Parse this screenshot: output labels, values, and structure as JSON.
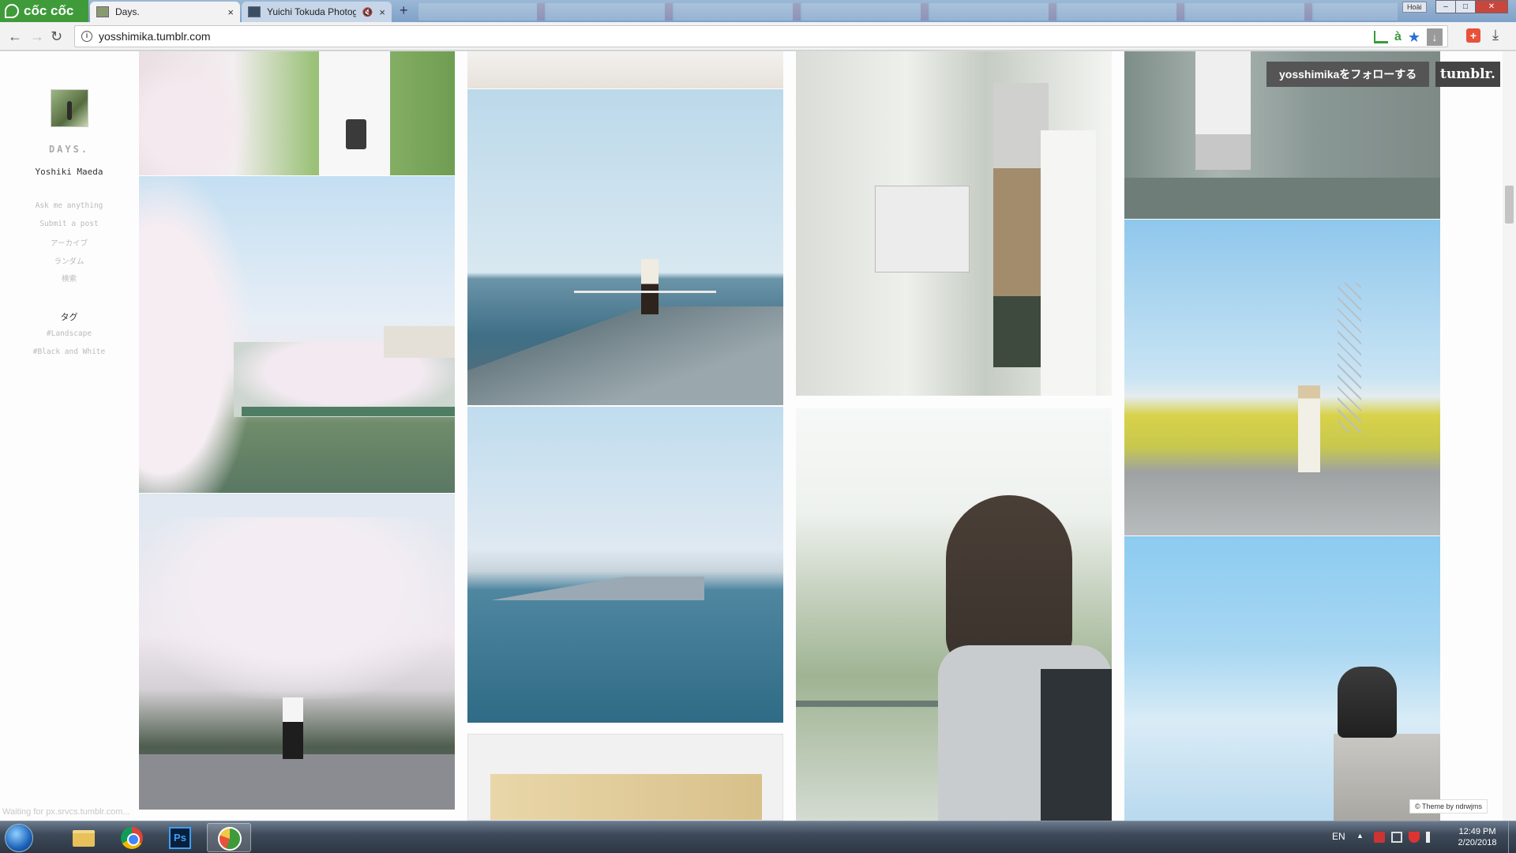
{
  "browser": {
    "brand": "cốc cốc",
    "tabs": [
      {
        "title": "Days.",
        "close": "×"
      },
      {
        "title": "Yuichi Tokuda Photogr",
        "close": "×",
        "mute": "🔇"
      }
    ],
    "new_tab": "+",
    "user_badge": "Hoài",
    "window_controls": {
      "minimize": "–",
      "maximize": "□",
      "close": "✕"
    },
    "url": "yosshimika.tumblr.com",
    "nav": {
      "back": "←",
      "forward": "→",
      "reload": "↻"
    },
    "icons": {
      "accent": "#3f9b3a",
      "star_color": "#2a6fd6",
      "extension_color": "#e8523a"
    },
    "amark": "à",
    "star": "★",
    "dl_box": "↓",
    "ext": "+",
    "dl": "⤓"
  },
  "blog": {
    "title": "DAYS.",
    "author": "Yoshiki Maeda",
    "nav_links": [
      "Ask me anything",
      "Submit a post",
      "アーカイブ",
      "ランダム",
      "検索"
    ],
    "tags_heading": "タグ",
    "tags": [
      "#Landscape",
      "#Black and White"
    ],
    "follow_label": "yosshimikaをフォローする",
    "tumblr_logo": "tumblr.",
    "theme_credit": "© Theme by ndrwjms",
    "status": "Waiting for px.srvcs.tumblr.com..."
  },
  "taskbar": {
    "ps_label": "Ps",
    "lang": "EN",
    "tray_arrow": "▲",
    "time": "12:49 PM",
    "date": "2/20/2018"
  }
}
